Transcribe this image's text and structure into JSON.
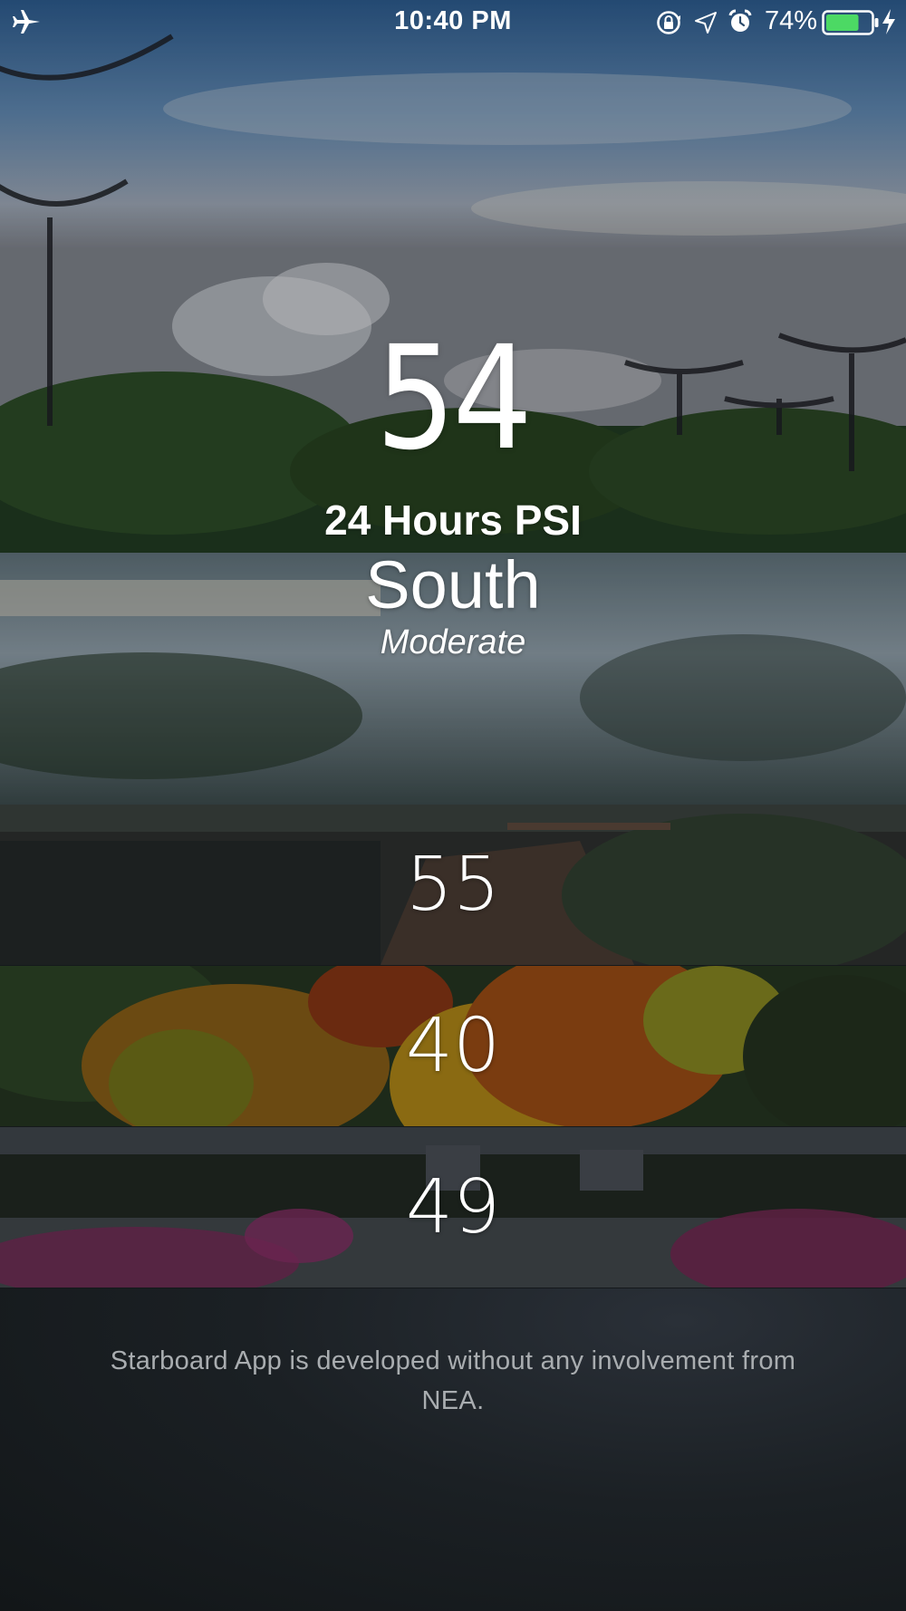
{
  "status_bar": {
    "time": "10:40 PM",
    "battery_percent": "74%",
    "battery_level": 0.74,
    "icons": [
      "airplane-icon",
      "orientation-lock-icon",
      "location-arrow-icon",
      "alarm-icon",
      "battery-icon",
      "charging-bolt-icon"
    ]
  },
  "main": {
    "psi_value": "54",
    "psi_label": "24 Hours PSI",
    "region": "South",
    "status": "Moderate"
  },
  "regions": [
    {
      "value": "55"
    },
    {
      "value": "40"
    },
    {
      "value": "49"
    }
  ],
  "footer": {
    "disclaimer": "Starboard App is developed without any involvement from NEA."
  },
  "colors": {
    "battery_fill": "#4cd964",
    "text": "#ffffff",
    "disclaimer_text": "#a9adb0",
    "footer_bg": "#15191c"
  }
}
